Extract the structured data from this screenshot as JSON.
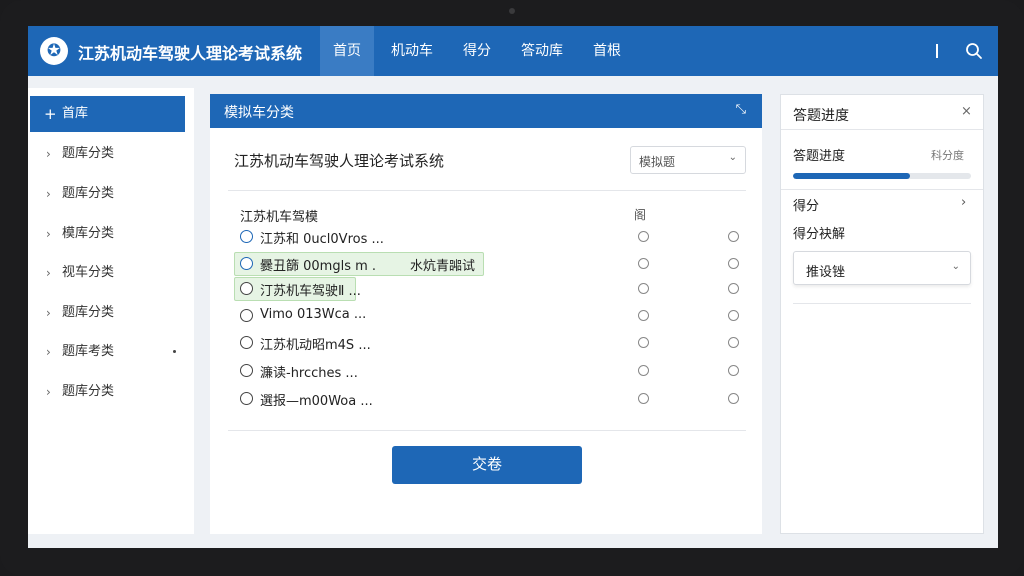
{
  "header": {
    "title": "江苏机动车驾驶人理论考试系统",
    "nav": [
      {
        "label": "首页",
        "active": true
      },
      {
        "label": "机动车",
        "active": false
      },
      {
        "label": "得分",
        "active": false
      },
      {
        "label": "答动库",
        "active": false
      },
      {
        "label": "首根",
        "active": false
      }
    ],
    "divider": "|"
  },
  "sidebar": {
    "items": [
      {
        "label": "首库",
        "active": true
      },
      {
        "label": "题库分类"
      },
      {
        "label": "题库分类"
      },
      {
        "label": "模库分类"
      },
      {
        "label": "视车分类"
      },
      {
        "label": "题库分类"
      },
      {
        "label": "题库考类"
      },
      {
        "label": "题库分类"
      }
    ]
  },
  "panel": {
    "title": "模拟车分类",
    "close_glyph": "⤡",
    "exam_title": "江苏机动车驾驶人理论考试系统",
    "select_value": "模拟题",
    "question_title": "江苏机车驾模",
    "column_header": "阁",
    "rows": [
      {
        "text": "江苏和 0ucl0Vros ...",
        "extra": "",
        "highlight": false
      },
      {
        "text": "爨丑篩 00mgls m   .",
        "extra": "水炕青嘂试",
        "highlight": true
      },
      {
        "text": "汀苏机车驾驶Ⅱ  ...",
        "extra": "",
        "highlight": true
      },
      {
        "text": "Vimo 013Wca  ...",
        "extra": "",
        "highlight": false
      },
      {
        "text": "江苏机动昭m4S  ...",
        "extra": "",
        "highlight": false
      },
      {
        "text": "濂读-hrcches  ...",
        "extra": "",
        "highlight": false
      },
      {
        "text": "選报—m00Woa  ...",
        "extra": "",
        "highlight": false
      }
    ],
    "submit_label": "交卷"
  },
  "right": {
    "title": "答题进度",
    "close_glyph": "×",
    "progress_label": "答题进度",
    "progress_hint": "科分度",
    "progress": 0.66,
    "score_label": "得分",
    "score_chevron": "›",
    "score_select_label": "得分袂解",
    "select_value": "推设锉"
  },
  "colors": {
    "primary": "#1e67b6",
    "highlight": "#e6f4e4"
  }
}
